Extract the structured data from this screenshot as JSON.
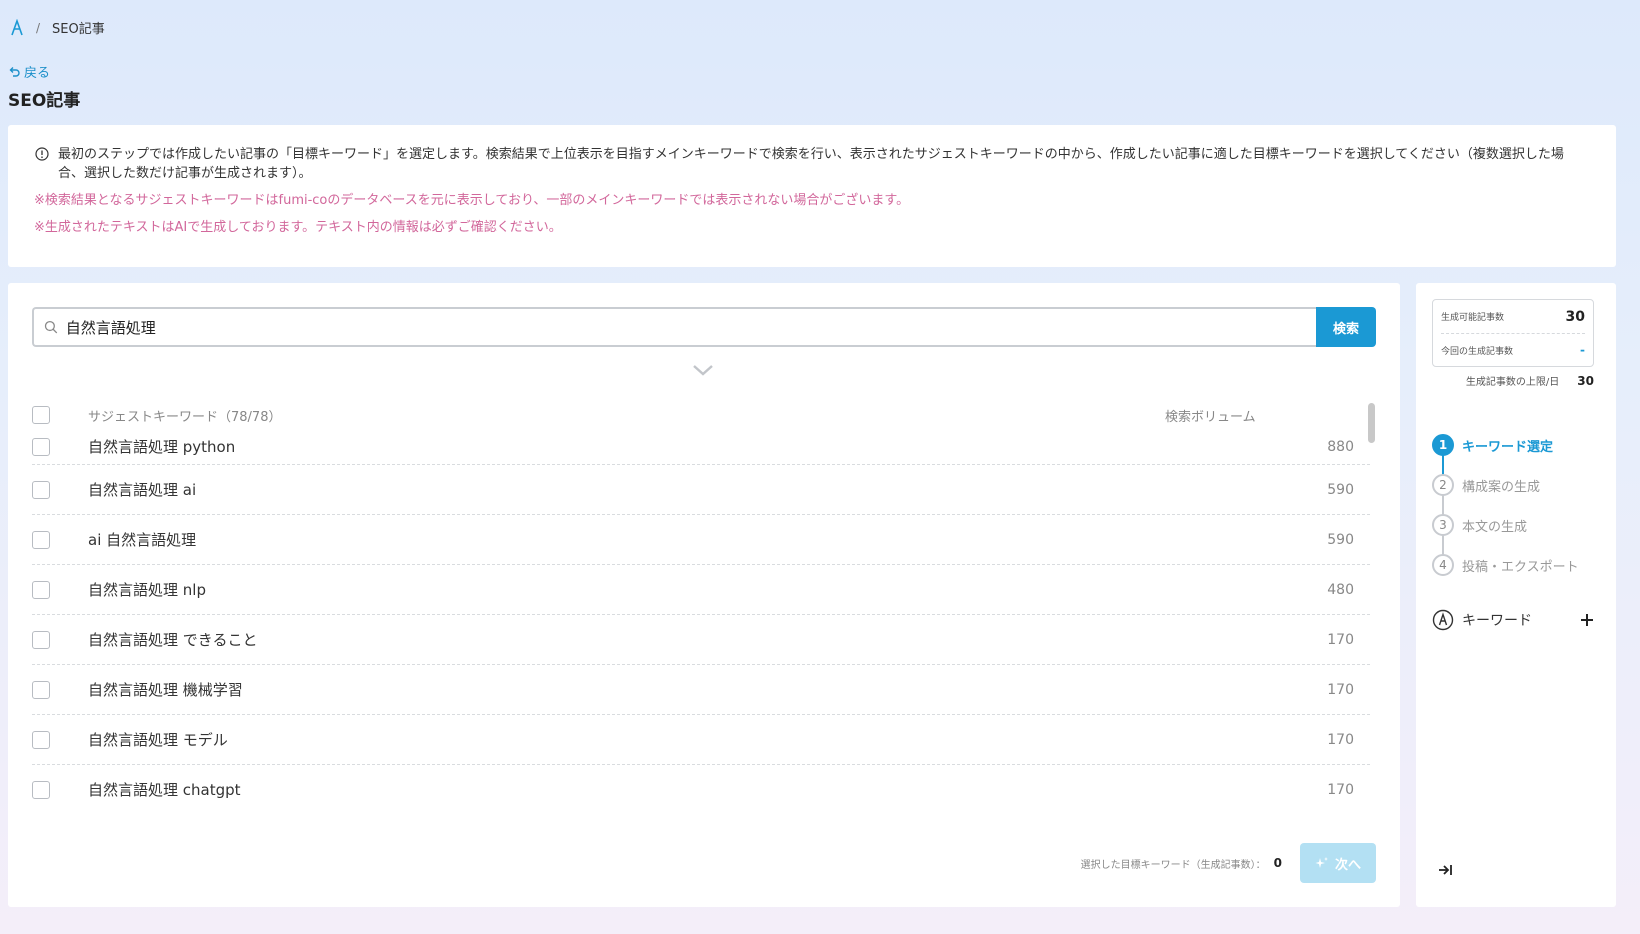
{
  "breadcrumb": {
    "current": "SEO記事",
    "separator": "/"
  },
  "back_label": "戻る",
  "page_title": "SEO記事",
  "info": {
    "main": "最初のステップでは作成したい記事の「目標キーワード」を選定します。検索結果で上位表示を目指すメインキーワードで検索を行い、表示されたサジェストキーワードの中から、作成したい記事に適した目標キーワードを選択してください（複数選択した場合、選択した数だけ記事が生成されます）。",
    "note1": "※検索結果となるサジェストキーワードはfumi-coのデータベースを元に表示しており、一部のメインキーワードでは表示されない場合がございます。",
    "note2": "※生成されたテキストはAIで生成しております。テキスト内の情報は必ずご確認ください。"
  },
  "search": {
    "value": "自然言語処理",
    "button_label": "検索"
  },
  "table": {
    "header_keyword": "サジェストキーワード（78/78）",
    "header_volume": "検索ボリューム",
    "rows": [
      {
        "keyword": "自然言語処理 python",
        "volume": "880"
      },
      {
        "keyword": "自然言語処理 ai",
        "volume": "590"
      },
      {
        "keyword": "ai 自然言語処理",
        "volume": "590"
      },
      {
        "keyword": "自然言語処理 nlp",
        "volume": "480"
      },
      {
        "keyword": "自然言語処理 できること",
        "volume": "170"
      },
      {
        "keyword": "自然言語処理 機械学習",
        "volume": "170"
      },
      {
        "keyword": "自然言語処理 モデル",
        "volume": "170"
      },
      {
        "keyword": "自然言語処理 chatgpt",
        "volume": "170"
      }
    ]
  },
  "footer": {
    "selected_label": "選択した目標キーワード（生成記事数）：",
    "selected_count": "0",
    "next_label": "次へ"
  },
  "sidebar": {
    "quota_available_label": "生成可能記事数",
    "quota_available_value": "30",
    "quota_current_label": "今回の生成記事数",
    "quota_current_value": "-",
    "daily_limit_label": "生成記事数の上限/日",
    "daily_limit_value": "30",
    "steps": [
      {
        "num": "1",
        "label": "キーワード選定"
      },
      {
        "num": "2",
        "label": "構成案の生成"
      },
      {
        "num": "3",
        "label": "本文の生成"
      },
      {
        "num": "4",
        "label": "投稿・エクスポート"
      }
    ],
    "active_step": 1,
    "keyword_section_label": "キーワード"
  },
  "colors": {
    "accent": "#1b99d4",
    "note_pink": "#d2679b",
    "next_disabled": "#b3e0f3"
  },
  "icons": {
    "breadcrumb_logo": "app-logo-icon",
    "back": "undo-arrow-icon",
    "info": "info-circle-icon",
    "search": "search-icon",
    "expand": "chevron-down-icon",
    "sparkle": "sparkle-icon",
    "keyword": "keyword-logo-icon",
    "add": "plus-icon",
    "collapse": "collapse-right-icon"
  }
}
